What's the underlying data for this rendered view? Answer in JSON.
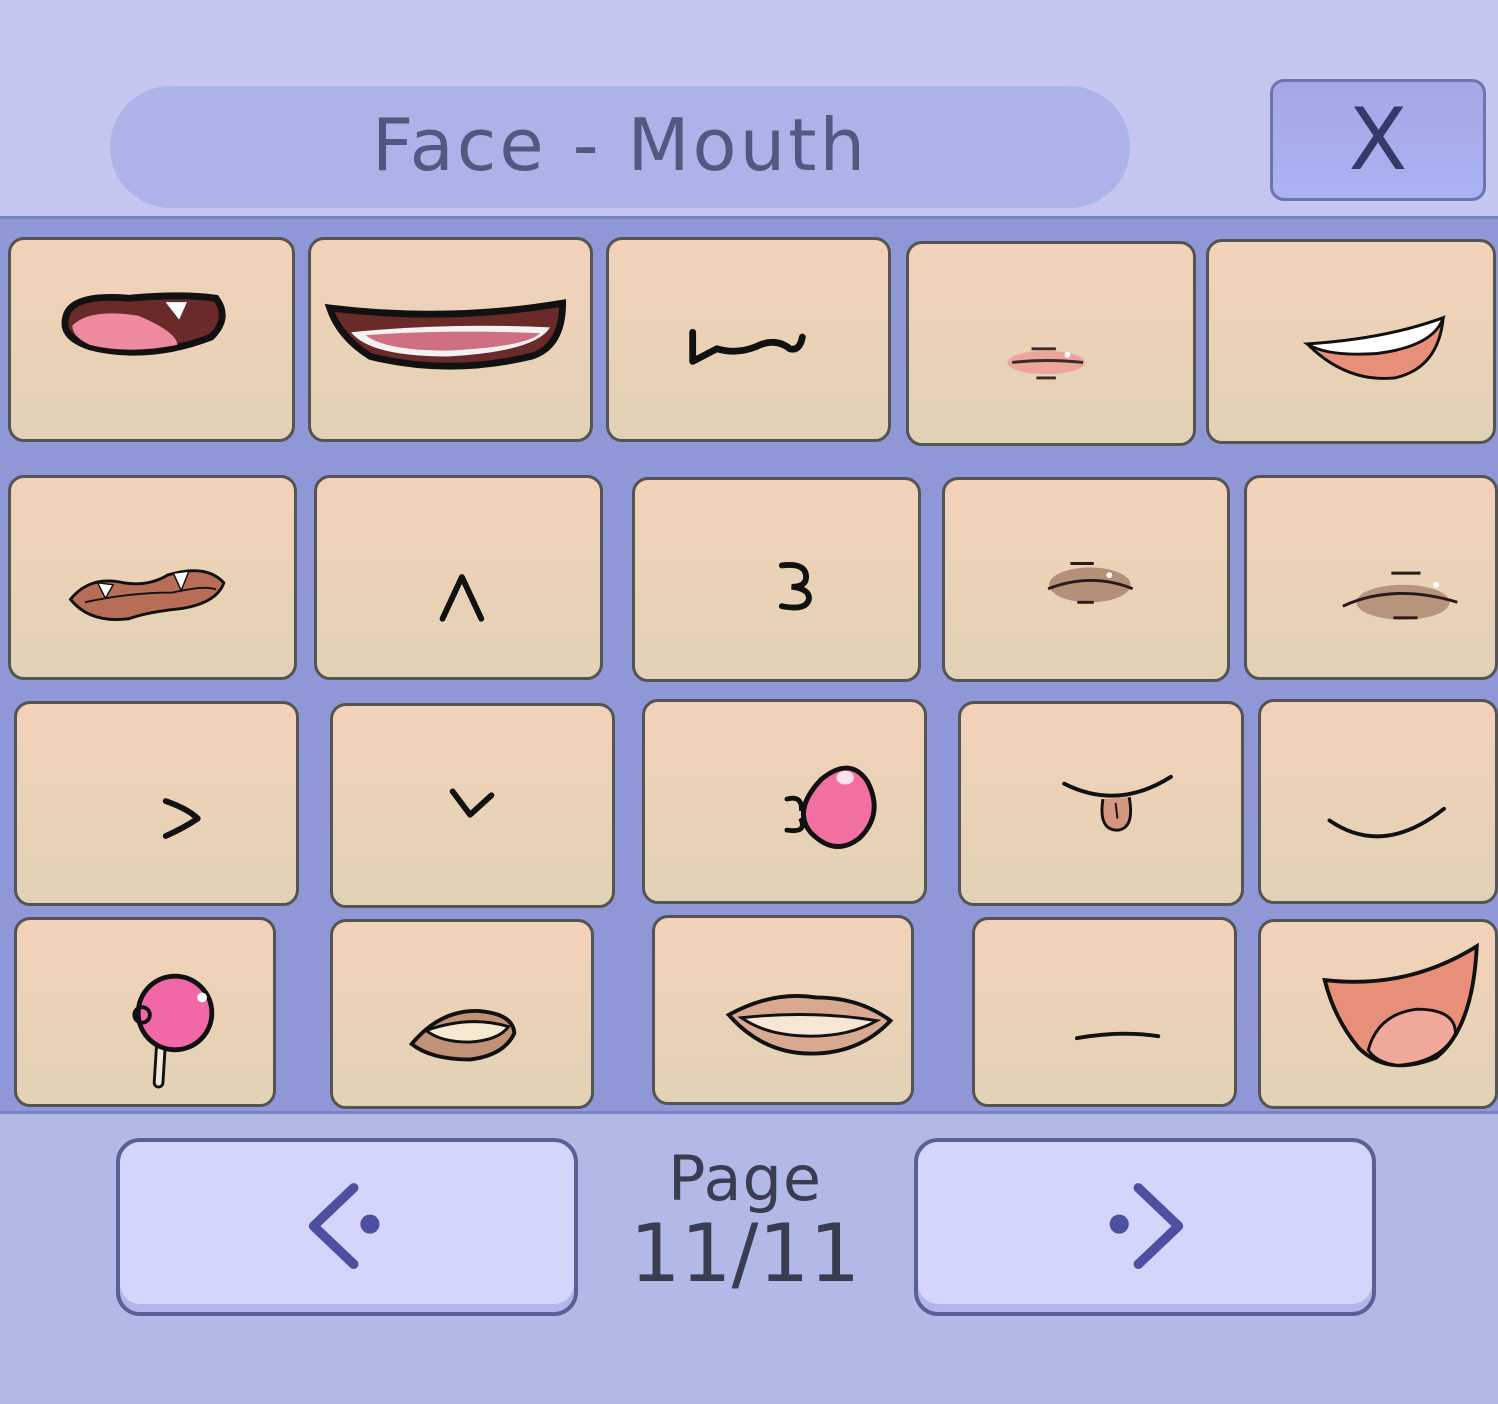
{
  "header": {
    "title": "Face - Mouth",
    "close_label": "X"
  },
  "grid": {
    "items": [
      {
        "name": "mouth-open-fang"
      },
      {
        "name": "mouth-wide-grin"
      },
      {
        "name": "mouth-cat-smirk"
      },
      {
        "name": "mouth-small-lips"
      },
      {
        "name": "mouth-smile-teeth"
      },
      {
        "name": "mouth-snarl-fangs"
      },
      {
        "name": "mouth-caret"
      },
      {
        "name": "mouth-three"
      },
      {
        "name": "mouth-lips-dark"
      },
      {
        "name": "mouth-lips-side"
      },
      {
        "name": "mouth-pout"
      },
      {
        "name": "mouth-v"
      },
      {
        "name": "mouth-bubblegum"
      },
      {
        "name": "mouth-tongue"
      },
      {
        "name": "mouth-smile"
      },
      {
        "name": "mouth-lollipop"
      },
      {
        "name": "mouth-bite-lip"
      },
      {
        "name": "mouth-full-lips"
      },
      {
        "name": "mouth-flat"
      },
      {
        "name": "mouth-big-laugh"
      }
    ]
  },
  "pagination": {
    "label": "Page",
    "value": "11/11",
    "prev_icon": "left-arrow-icon",
    "next_icon": "right-arrow-icon"
  },
  "colors": {
    "background": "#b3b9e6",
    "header": "#c4c6f0",
    "grid": "#8f97d6",
    "tile": "#f0d2ba",
    "button": "#d3d5fb",
    "text": "#545780"
  }
}
